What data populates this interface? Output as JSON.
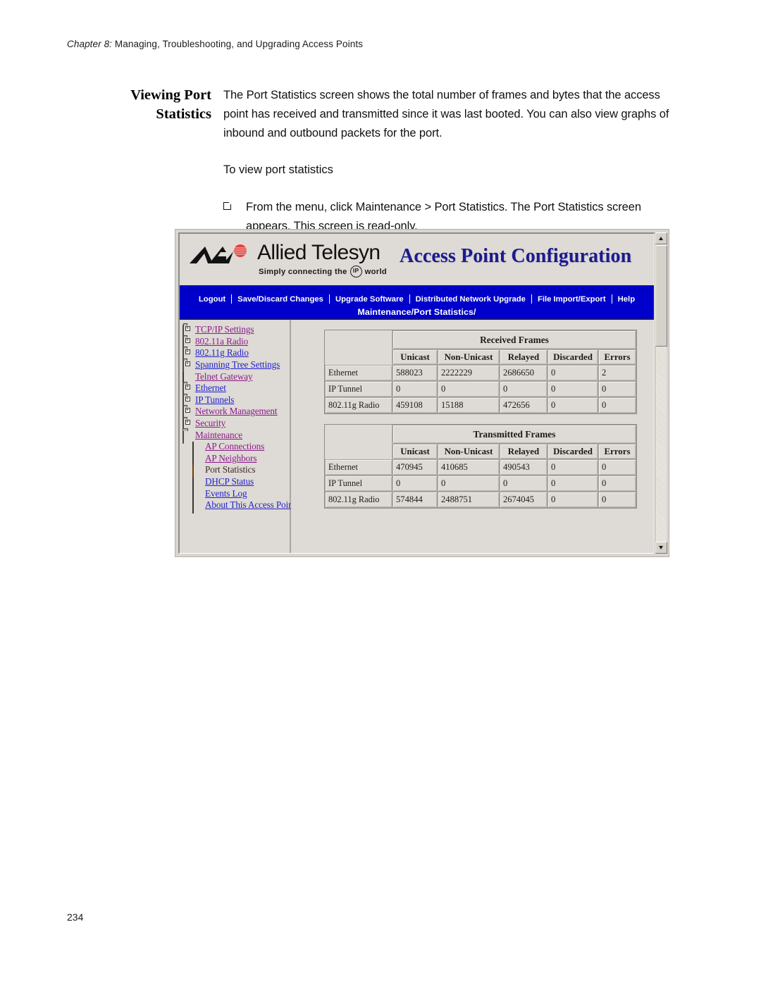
{
  "page": {
    "running_head_chapter": "Chapter 8:",
    "running_head_rest": " Managing, Troubleshooting, and Upgrading Access Points",
    "page_number": "234"
  },
  "section": {
    "title_line1": "Viewing Port",
    "title_line2": "Statistics",
    "paragraph": "The Port Statistics screen shows the total number of frames and bytes that the access point has received and transmitted since it was last booted. You can also view graphs of inbound and outbound packets for the port.",
    "sub_head": "To view port statistics",
    "step_text": "From the menu, click Maintenance > Port Statistics. The Port Statistics screen appears. This screen is read-only."
  },
  "screenshot": {
    "logo": {
      "wordmark": "Allied Telesyn",
      "tagline_before": "Simply connecting the",
      "tagline_badge": "IP",
      "tagline_after": "world",
      "mark_icon": "allied-telesyn-logo-icon"
    },
    "app_title": "Access Point Configuration",
    "title_color": "#1b1b8c",
    "menu_bar": {
      "items": [
        "Logout",
        "Save/Discard Changes",
        "Upgrade Software",
        "Distributed Network Upgrade",
        "File Import/Export",
        "Help"
      ],
      "background": "#0000cc"
    },
    "breadcrumb": "Maintenance/Port Statistics/",
    "nav_tree": [
      {
        "label": "TCP/IP Settings",
        "icon": "folder-closed-icon",
        "state": "visited",
        "indent": 0
      },
      {
        "label": "802.11a Radio",
        "icon": "folder-closed-icon",
        "state": "visited",
        "indent": 0
      },
      {
        "label": "802.11g Radio",
        "icon": "folder-closed-icon",
        "state": "unvisited",
        "indent": 0
      },
      {
        "label": "Spanning Tree Settings",
        "icon": "folder-closed-icon",
        "state": "unvisited",
        "indent": 0
      },
      {
        "label": "Telnet Gateway",
        "icon": "document-icon",
        "state": "visited",
        "indent": 0
      },
      {
        "label": "Ethernet",
        "icon": "folder-closed-icon",
        "state": "unvisited",
        "indent": 0
      },
      {
        "label": "IP Tunnels",
        "icon": "folder-closed-icon",
        "state": "unvisited",
        "indent": 0
      },
      {
        "label": "Network Management",
        "icon": "folder-closed-icon",
        "state": "visited",
        "indent": 0
      },
      {
        "label": "Security",
        "icon": "folder-closed-icon",
        "state": "visited",
        "indent": 0
      },
      {
        "label": "Maintenance",
        "icon": "folder-open-icon",
        "state": "visited",
        "indent": 0
      },
      {
        "label": "AP Connections",
        "icon": "document-icon",
        "state": "visited",
        "indent": 1
      },
      {
        "label": "AP Neighbors",
        "icon": "document-icon",
        "state": "visited",
        "indent": 1
      },
      {
        "label": "Port Statistics",
        "icon": "document-active-icon",
        "state": "current",
        "indent": 1
      },
      {
        "label": "DHCP Status",
        "icon": "document-icon",
        "state": "unvisited",
        "indent": 1
      },
      {
        "label": "Events Log",
        "icon": "document-icon",
        "state": "unvisited",
        "indent": 1
      },
      {
        "label": "About This Access Point",
        "icon": "document-icon",
        "state": "unvisited",
        "indent": 1
      }
    ],
    "tables": [
      {
        "group_header": "Received Frames",
        "columns": [
          "Unicast",
          "Non-Unicast",
          "Relayed",
          "Discarded",
          "Errors"
        ],
        "rows": [
          {
            "label": "Ethernet",
            "values": [
              "588023",
              "2222229",
              "2686650",
              "0",
              "2"
            ]
          },
          {
            "label": "IP Tunnel",
            "values": [
              "0",
              "0",
              "0",
              "0",
              "0"
            ]
          },
          {
            "label": "802.11g Radio",
            "values": [
              "459108",
              "15188",
              "472656",
              "0",
              "0"
            ]
          }
        ]
      },
      {
        "group_header": "Transmitted Frames",
        "columns": [
          "Unicast",
          "Non-Unicast",
          "Relayed",
          "Discarded",
          "Errors"
        ],
        "rows": [
          {
            "label": "Ethernet",
            "values": [
              "470945",
              "410685",
              "490543",
              "0",
              "0"
            ]
          },
          {
            "label": "IP Tunnel",
            "values": [
              "0",
              "0",
              "0",
              "0",
              "0"
            ]
          },
          {
            "label": "802.11g Radio",
            "values": [
              "574844",
              "2488751",
              "2674045",
              "0",
              "0"
            ]
          }
        ]
      }
    ],
    "scrollbar": {
      "up_icon": "scroll-up-arrow-icon",
      "down_icon": "scroll-down-arrow-icon"
    }
  }
}
